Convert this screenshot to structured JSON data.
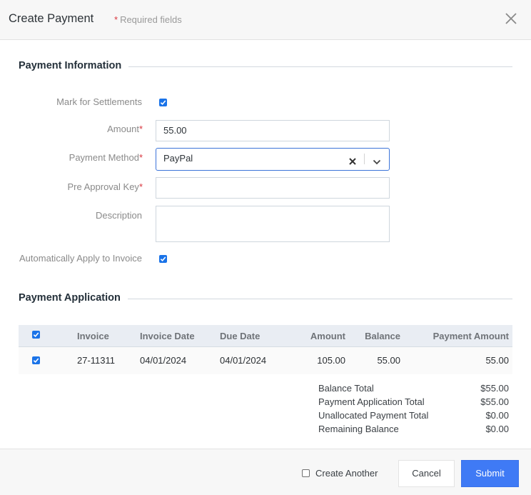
{
  "dialog": {
    "title": "Create Payment",
    "required_star": "*",
    "required_note": "Required fields",
    "close_icon": "close-icon"
  },
  "payment_information": {
    "section_title": "Payment Information",
    "mark_for_settlements": {
      "label": "Mark for Settlements",
      "checked": true
    },
    "amount": {
      "label": "Amount",
      "required": "*",
      "value": "55.00"
    },
    "payment_method": {
      "label": "Payment Method",
      "required": "*",
      "value": "PayPal",
      "clear_icon": "clear-icon",
      "dropdown_icon": "chevron-down-icon"
    },
    "pre_approval_key": {
      "label": "Pre Approval Key",
      "required": "*",
      "value": ""
    },
    "description": {
      "label": "Description",
      "value": ""
    },
    "auto_apply": {
      "label": "Automatically Apply to Invoice",
      "checked": true
    }
  },
  "payment_application": {
    "section_title": "Payment Application",
    "columns": [
      "Invoice",
      "Invoice Date",
      "Due Date",
      "Amount",
      "Balance",
      "Payment Amount"
    ],
    "select_all_checked": true,
    "rows": [
      {
        "checked": true,
        "invoice": "27-11311",
        "invoice_date": "04/01/2024",
        "due_date": "04/01/2024",
        "amount": "105.00",
        "balance": "55.00",
        "payment_amount": "55.00"
      }
    ],
    "totals": [
      {
        "label": "Balance Total",
        "value": "$55.00"
      },
      {
        "label": "Payment Application Total",
        "value": "$55.00"
      },
      {
        "label": "Unallocated Payment Total",
        "value": "$0.00"
      },
      {
        "label": "Remaining Balance",
        "value": "$0.00"
      }
    ]
  },
  "footer": {
    "create_another": {
      "label": "Create Another",
      "checked": false
    },
    "cancel_label": "Cancel",
    "submit_label": "Submit"
  },
  "colors": {
    "accent": "#3f7af5",
    "checkbox": "#1a73e8",
    "required": "#d9363e"
  }
}
